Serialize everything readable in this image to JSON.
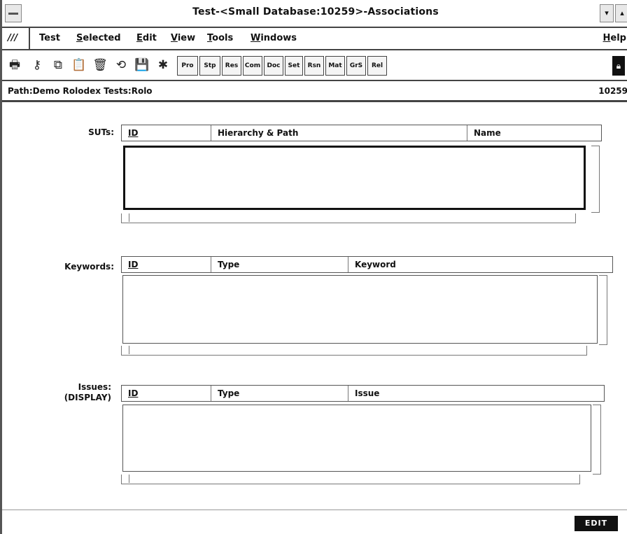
{
  "window": {
    "title": "Test-<Small Database:10259>-Associations",
    "sysmenu_icon": "minus-bar-icon",
    "buttons": [
      "▾",
      "▴"
    ]
  },
  "menubar": {
    "prefix": "///",
    "items": [
      {
        "u": "",
        "rest": "Test"
      },
      {
        "u": "S",
        "rest": "elected"
      },
      {
        "u": "E",
        "rest": "dit"
      },
      {
        "u": "V",
        "rest": "iew"
      },
      {
        "u": "T",
        "rest": "ools"
      },
      {
        "u": "W",
        "rest": "indows"
      }
    ],
    "help": {
      "u": "H",
      "rest": "elp"
    }
  },
  "toolbar": {
    "icons": [
      "printer-icon",
      "key-icon",
      "copy-icon",
      "paste-icon",
      "delete-icon",
      "refresh-icon",
      "save-icon",
      "run-icon"
    ],
    "icon_glyphs": [
      "🖶",
      "⚷",
      "⧉",
      "📋",
      "🗑",
      "⟲",
      "💾",
      "✱"
    ],
    "buttons": [
      "Pro",
      "Stp",
      "Res",
      "Com",
      "Doc",
      "Set",
      "Rsn",
      "Mat",
      "GrS",
      "Rel"
    ],
    "lock_icon": "lock-icon"
  },
  "path": {
    "text": "Path:Demo Rolodex Tests:Rolo",
    "record_id": "10259"
  },
  "suts": {
    "label": "SUTs:",
    "columns": [
      "ID",
      "Hierarchy & Path",
      "Name"
    ]
  },
  "keywords": {
    "label": "Keywords:",
    "columns": [
      "ID",
      "Type",
      "Keyword"
    ]
  },
  "issues": {
    "label_line1": "Issues:",
    "label_line2": "(DISPLAY)",
    "columns": [
      "ID",
      "Type",
      "Issue"
    ]
  },
  "status": {
    "mode": "EDIT"
  }
}
